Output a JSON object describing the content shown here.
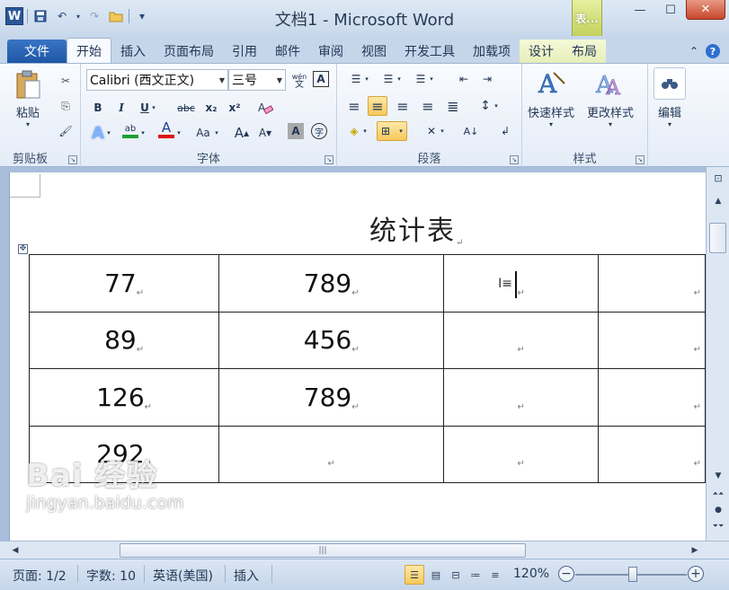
{
  "window": {
    "title": "文档1 - Microsoft Word",
    "table_tools_tab": "表...",
    "controls": {
      "minimize": "—",
      "maximize": "☐",
      "close": "✕"
    }
  },
  "quick_access": {
    "app_icon": "W",
    "save": "💾",
    "undo": "↶",
    "redo": "↷",
    "open": "📂",
    "customize": "▾"
  },
  "tabs": [
    "文件",
    "开始",
    "插入",
    "页面布局",
    "引用",
    "邮件",
    "审阅",
    "视图",
    "开发工具",
    "加载项",
    "设计",
    "布局"
  ],
  "ribbon": {
    "clipboard": {
      "label": "剪贴板",
      "paste": "粘贴",
      "cut_icon": "✂",
      "copy_icon": "⎘",
      "format_painter_icon": "🖌"
    },
    "font": {
      "label": "字体",
      "font_name": "Calibri (西文正文)",
      "font_size": "三号",
      "phonetic": "wén",
      "border_char": "A",
      "bold": "B",
      "italic": "I",
      "underline": "U",
      "strikethrough": "abc",
      "subscript": "x₂",
      "superscript": "x²",
      "clear": "A",
      "text_effect": "A",
      "highlight": "ab",
      "font_color": "A",
      "change_case": "Aa",
      "grow": "A",
      "shrink": "A",
      "char_shading": "A",
      "enclosed": "字"
    },
    "paragraph": {
      "label": "段落",
      "bullets": "☰",
      "numbering": "☰",
      "multilevel": "☰",
      "decrease_indent": "⇤",
      "increase_indent": "⇥",
      "align_left": "≡",
      "align_center": "≡",
      "align_right": "≡",
      "justify": "≡",
      "distributed": "≣",
      "line_spacing": "↕",
      "shading": "◈",
      "borders": "⊞",
      "chinese_layout": "✕",
      "sort": "A↓",
      "show_marks": "↲"
    },
    "styles": {
      "label": "样式",
      "quick_styles": "快速样式",
      "change_styles": "更改样式"
    },
    "editing": {
      "label": "编辑",
      "edit": "编辑"
    }
  },
  "document": {
    "title": "统计表",
    "table": [
      [
        "77",
        "789",
        "",
        ""
      ],
      [
        "89",
        "456",
        "",
        ""
      ],
      [
        "126",
        "789",
        "",
        ""
      ],
      [
        "292",
        "",
        "",
        ""
      ]
    ],
    "pilcrow": "↵",
    "watermark_main": "Bai 经验",
    "watermark_sub": "jingyan.baidu.com"
  },
  "hscroll": {
    "grip": "|||"
  },
  "statusbar": {
    "page": "页面: 1/2",
    "words": "字数: 10",
    "language": "英语(美国)",
    "mode": "插入",
    "zoom": "120%",
    "zoom_out": "−",
    "zoom_in": "+"
  }
}
